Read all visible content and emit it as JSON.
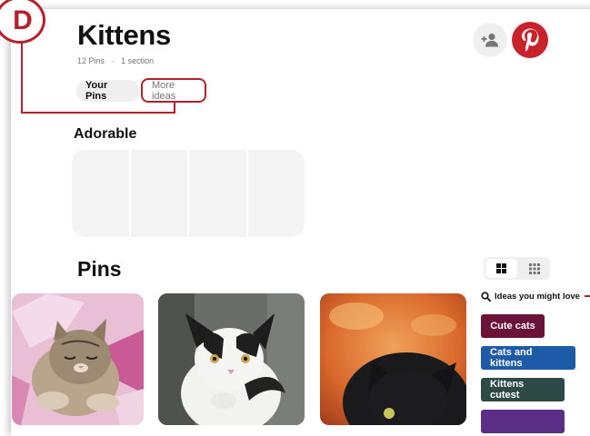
{
  "annotation": {
    "letter": "D"
  },
  "board": {
    "title": "Kittens",
    "pin_count": "12 Pins",
    "separator": "·",
    "section_count": "1 section"
  },
  "tabs": [
    {
      "label": "Your Pins",
      "active": true
    },
    {
      "label": "More ideas",
      "active": false
    }
  ],
  "header_icons": [
    "add-collaborator-icon",
    "pinterest-logo-icon"
  ],
  "section": {
    "title": "Adorable"
  },
  "pins_section": {
    "title": "Pins",
    "view_options": [
      "grid-large-icon",
      "grid-small-icon"
    ],
    "active_view": "grid-large-icon"
  },
  "ideas": {
    "heading": "Ideas you might love",
    "chips": [
      {
        "label": "Cute cats",
        "color": "#6b1239"
      },
      {
        "label": "Cats and kittens",
        "color": "#1d5ba8"
      },
      {
        "label": "Kittens cutest",
        "color": "#2e4a46"
      },
      {
        "label": "",
        "color": "#5a2d86"
      }
    ]
  },
  "colors": {
    "accent": "#b5202a",
    "pinterest_red": "#c8232c",
    "pill_bg": "#efefef",
    "muted_text": "#767676"
  }
}
